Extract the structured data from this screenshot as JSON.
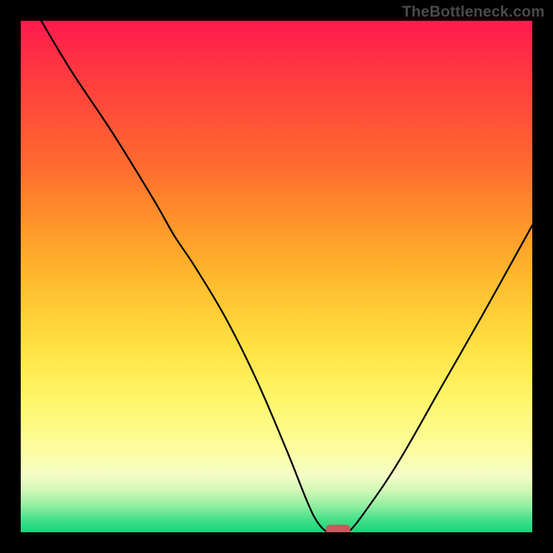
{
  "watermark": "TheBottleneck.com",
  "colors": {
    "frame_background": "#000000",
    "curve_stroke": "#000000",
    "marker_fill": "#c75a5a",
    "watermark_text": "#4a4a4a",
    "gradient_top": "#ff1a4d",
    "gradient_bottom": "#17d47c"
  },
  "chart_data": {
    "type": "line",
    "title": "",
    "xlabel": "",
    "ylabel": "",
    "xlim": [
      0,
      100
    ],
    "ylim": [
      0,
      100
    ],
    "grid": false,
    "legend": false,
    "series": [
      {
        "name": "bottleneck-curve",
        "x": [
          4,
          10,
          18,
          26,
          30,
          34,
          40,
          46,
          52,
          56,
          58,
          60,
          62,
          64,
          68,
          74,
          82,
          90,
          100
        ],
        "y": [
          100,
          90,
          78,
          65,
          58,
          52,
          42,
          30,
          16,
          6,
          2,
          0,
          0,
          0,
          5,
          14,
          28,
          42,
          60
        ]
      }
    ],
    "marker": {
      "x": 62,
      "y": 0
    },
    "background_gradient": {
      "orientation": "vertical",
      "stops": [
        {
          "pos": 0.0,
          "hex": "#ff1a4d"
        },
        {
          "pos": 0.12,
          "hex": "#ff3e3e"
        },
        {
          "pos": 0.28,
          "hex": "#ff6a2f"
        },
        {
          "pos": 0.4,
          "hex": "#ff962a"
        },
        {
          "pos": 0.52,
          "hex": "#ffbf2e"
        },
        {
          "pos": 0.64,
          "hex": "#ffe244"
        },
        {
          "pos": 0.74,
          "hex": "#fff66a"
        },
        {
          "pos": 0.84,
          "hex": "#fdfda0"
        },
        {
          "pos": 0.89,
          "hex": "#f3fcc7"
        },
        {
          "pos": 0.92,
          "hex": "#cff7b6"
        },
        {
          "pos": 0.95,
          "hex": "#8eeea0"
        },
        {
          "pos": 0.975,
          "hex": "#45e08a"
        },
        {
          "pos": 1.0,
          "hex": "#17d47c"
        }
      ]
    }
  }
}
